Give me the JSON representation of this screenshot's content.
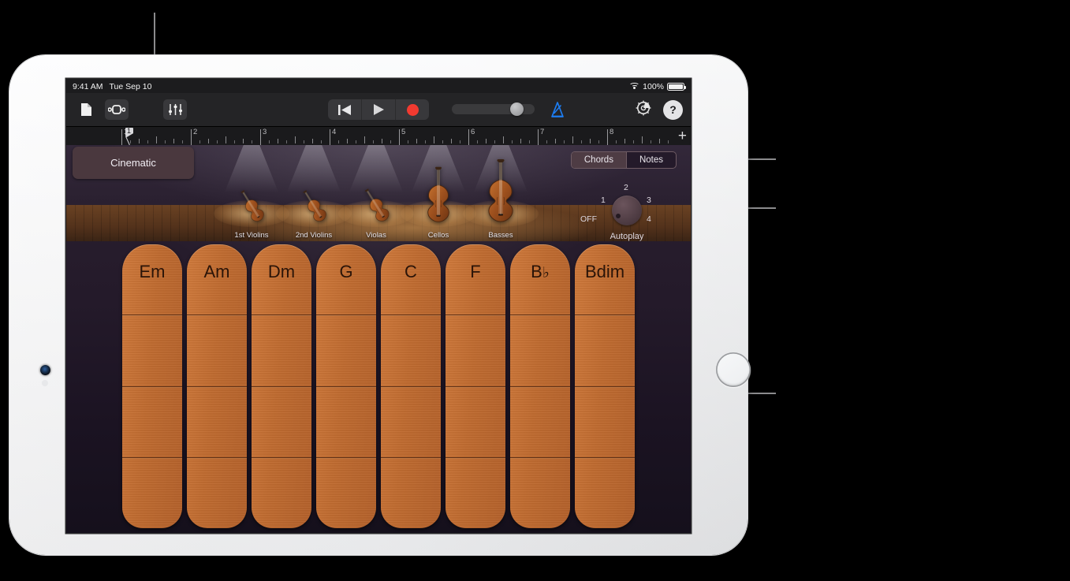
{
  "device": {
    "name": "ipad",
    "orientation": "landscape"
  },
  "status_bar": {
    "time": "9:41 AM",
    "date": "Tue Sep 10",
    "battery_percent": "100%",
    "wifi_icon": "wifi-icon",
    "battery_icon": "battery-icon"
  },
  "toolbar": {
    "my_songs_icon": "document-icon",
    "browser_icon": "loop-browser-icon",
    "track_controls_icon": "mixer-faders-icon",
    "rewind_icon": "rewind-icon",
    "play_icon": "play-icon",
    "record_icon": "record-icon",
    "master_volume_label": "master-volume-slider",
    "metronome_icon": "metronome-icon",
    "metronome_color": "#1d7df2",
    "settings_icon": "gear-icon",
    "help_label": "?",
    "add_label": "+"
  },
  "ruler": {
    "bars": [
      "1",
      "2",
      "3",
      "4",
      "5",
      "6",
      "7",
      "8"
    ],
    "playhead_bar": "1"
  },
  "instrument": {
    "patch_name": "Cinematic",
    "mode_toggle": {
      "options": [
        "Chords",
        "Notes"
      ],
      "selected": "Chords"
    },
    "autoplay": {
      "title": "Autoplay",
      "positions": [
        "OFF",
        "1",
        "2",
        "3",
        "4"
      ],
      "selected": "OFF"
    },
    "stage_instruments": [
      {
        "label": "1st Violins",
        "art": "violin-icon"
      },
      {
        "label": "2nd Violins",
        "art": "violin-icon"
      },
      {
        "label": "Violas",
        "art": "viola-icon"
      },
      {
        "label": "Cellos",
        "art": "cello-icon"
      },
      {
        "label": "Basses",
        "art": "double-bass-icon"
      }
    ],
    "chord_strips": [
      {
        "name": "Em",
        "root": "Em",
        "flat": ""
      },
      {
        "name": "Am",
        "root": "Am",
        "flat": ""
      },
      {
        "name": "Dm",
        "root": "Dm",
        "flat": ""
      },
      {
        "name": "G",
        "root": "G",
        "flat": ""
      },
      {
        "name": "C",
        "root": "C",
        "flat": ""
      },
      {
        "name": "F",
        "root": "F",
        "flat": ""
      },
      {
        "name": "Bb",
        "root": "B",
        "flat": "♭"
      },
      {
        "name": "Bdim",
        "root": "Bdim",
        "flat": ""
      }
    ],
    "segments_per_strip": 4
  },
  "colors": {
    "chord_wood": "#c06c31",
    "stage_bg": "#2b2030",
    "accent_blue": "#1d7df2",
    "record_red": "#f23a30",
    "callout_gray": "#8b8b8d"
  }
}
